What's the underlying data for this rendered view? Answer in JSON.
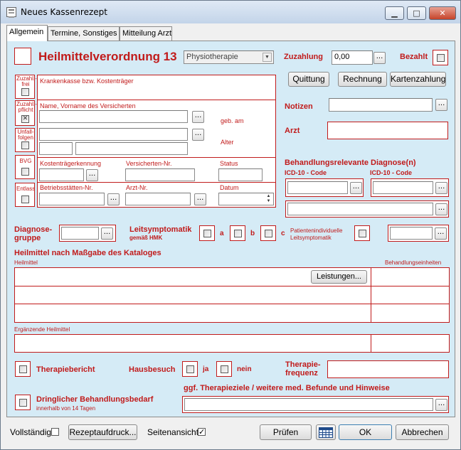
{
  "window": {
    "title": "Neues Kassenrezept",
    "minimize": "▁",
    "maximize": "□",
    "close": "✕"
  },
  "tabs": [
    "Allgemein",
    "Termine, Sonstiges",
    "Mitteilung Arzt"
  ],
  "header": {
    "heading": "Heilmittelverordnung 13",
    "therapy_type": "Physiotherapie",
    "zuzahlung_label": "Zuzahlung",
    "zuzahlung_value": "0,00",
    "bezahlt_label": "Bezahlt"
  },
  "payment_buttons": [
    "Quittung",
    "Rechnung",
    "Kartenzahlung"
  ],
  "left_checks": [
    "Zuzahl.-frei",
    "Zuzahl.-pflicht",
    "Unfall-folgen",
    "BVG",
    "Entlass"
  ],
  "patient": {
    "kostentraeger_label": "Krankenkasse bzw. Kostenträger",
    "name_label": "Name, Vorname des Versicherten",
    "geb_label": "geb. am",
    "alter_label": "Alter",
    "kennung_label": "Kostenträgerkennung",
    "versichertennr_label": "Versicherten-Nr.",
    "status_label": "Status",
    "betriebsstaetten_label": "Betriebsstätten-Nr.",
    "arztnr_label": "Arzt-Nr.",
    "datum_label": "Datum"
  },
  "right_section": {
    "notizen_label": "Notizen",
    "arzt_label": "Arzt",
    "diagnose_heading": "Behandlungsrelevante Diagnose(n)",
    "icd1_label": "ICD-10 - Code",
    "icd2_label": "ICD-10 - Code"
  },
  "diagnose_row": {
    "gruppe_label_1": "Diagnose-",
    "gruppe_label_2": "gruppe",
    "leitsymptomatik_label": "Leitsymptomatik",
    "hmk_label": "gemäß HMK",
    "a_label": "a",
    "b_label": "b",
    "c_label": "c",
    "patient_label_1": "Patientenindividuelle",
    "patient_label_2": "Leitsymptomatik"
  },
  "heilmittel": {
    "heading": "Heilmittel nach Maßgabe des Kataloges",
    "col1": "Heilmittel",
    "col2": "Behandlungseinheiten",
    "leistungen_button": "Leistungen...",
    "ergaenzende_label": "Ergänzende Heilmittel"
  },
  "bottom_section": {
    "therapiebericht_label": "Therapiebericht",
    "hausbesuch_label": "Hausbesuch",
    "ja_label": "ja",
    "nein_label": "nein",
    "frequenz_label_1": "Therapie-",
    "frequenz_label_2": "frequenz",
    "dringlich_label": "Dringlicher Behandlungsbedarf",
    "dringlich_sub": "innerhalb von 14 Tagen",
    "therapieziele_label": "ggf. Therapieziele / weitere med. Befunde und Hinweise"
  },
  "footer": {
    "vollstaendig_label": "Vollständig",
    "rezeptaufdruck_button": "Rezeptaufdruck...",
    "seitenansicht_label": "Seitenansicht",
    "pruefen_button": "Prüfen",
    "ok_button": "OK",
    "abbrechen_button": "Abbrechen"
  },
  "ellipsis": "...",
  "checked_mark": "✓",
  "colors": {
    "accent": "#c11b1b",
    "panel": "#d5ebf6"
  },
  "icons": [
    "calculator-icon",
    "app-icon",
    "spin-arrows-icon",
    "dropdown-arrow-icon"
  ]
}
